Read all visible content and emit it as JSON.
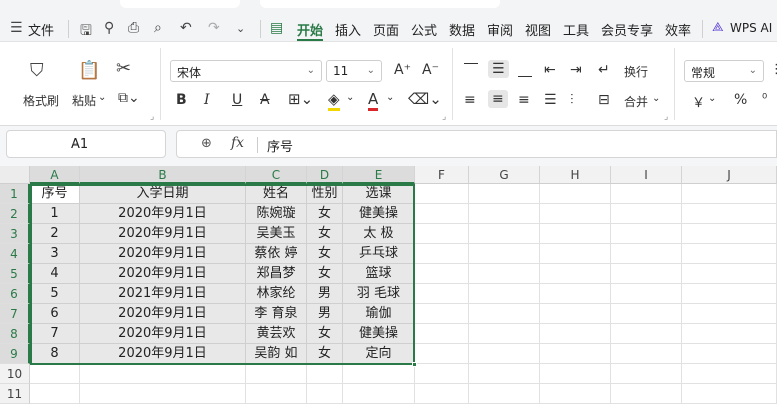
{
  "menubar": {
    "file_label": "文件",
    "tabs": [
      "开始",
      "插入",
      "页面",
      "公式",
      "数据",
      "审阅",
      "视图",
      "工具",
      "会员专享",
      "效率"
    ],
    "ai_label": "WPS AI",
    "icons": [
      "hamburger-icon",
      "save-icon",
      "format-painter-icon",
      "print-icon",
      "print-preview-icon",
      "undo-icon",
      "redo-icon",
      "chevron-down-icon"
    ]
  },
  "ribbon": {
    "format_painter": "格式刷",
    "paste": "粘贴",
    "font_name": "宋体",
    "font_size": "11",
    "wrap": "换行",
    "merge": "合并",
    "number_format": "常规",
    "currency": "￥",
    "percent": "%"
  },
  "formula_bar": {
    "cell_ref": "A1",
    "fx_label": "fx",
    "content": "序号"
  },
  "columns": [
    "A",
    "B",
    "C",
    "D",
    "E",
    "F",
    "G",
    "H",
    "I",
    "J"
  ],
  "rows": [
    "1",
    "2",
    "3",
    "4",
    "5",
    "6",
    "7",
    "8",
    "9",
    "10",
    "11"
  ],
  "table": {
    "headers": [
      "序号",
      "入学日期",
      "姓名",
      "性别",
      "选课"
    ],
    "rows": [
      [
        "1",
        "2020年9月1日",
        "陈婉璇",
        "女",
        "健美操"
      ],
      [
        "2",
        "2020年9月1日",
        "吴美玉",
        "女",
        "太 极"
      ],
      [
        "3",
        "2020年9月1日",
        "蔡依 婷",
        "女",
        "乒乓球"
      ],
      [
        "4",
        "2020年9月1日",
        "郑昌梦",
        "女",
        "篮球"
      ],
      [
        "5",
        "2021年9月1日",
        "林家纶",
        "男",
        "羽 毛球"
      ],
      [
        "6",
        "2020年9月1日",
        "李 育泉",
        "男",
        "瑜伽"
      ],
      [
        "7",
        "2020年9月1日",
        "黄芸欢",
        "女",
        "健美操"
      ],
      [
        "8",
        "2020年9月1日",
        "吴韵 如",
        "女",
        "定向"
      ]
    ]
  },
  "colors": {
    "accent": "#2a7a47",
    "selection_fill": "#e8e8e8"
  }
}
